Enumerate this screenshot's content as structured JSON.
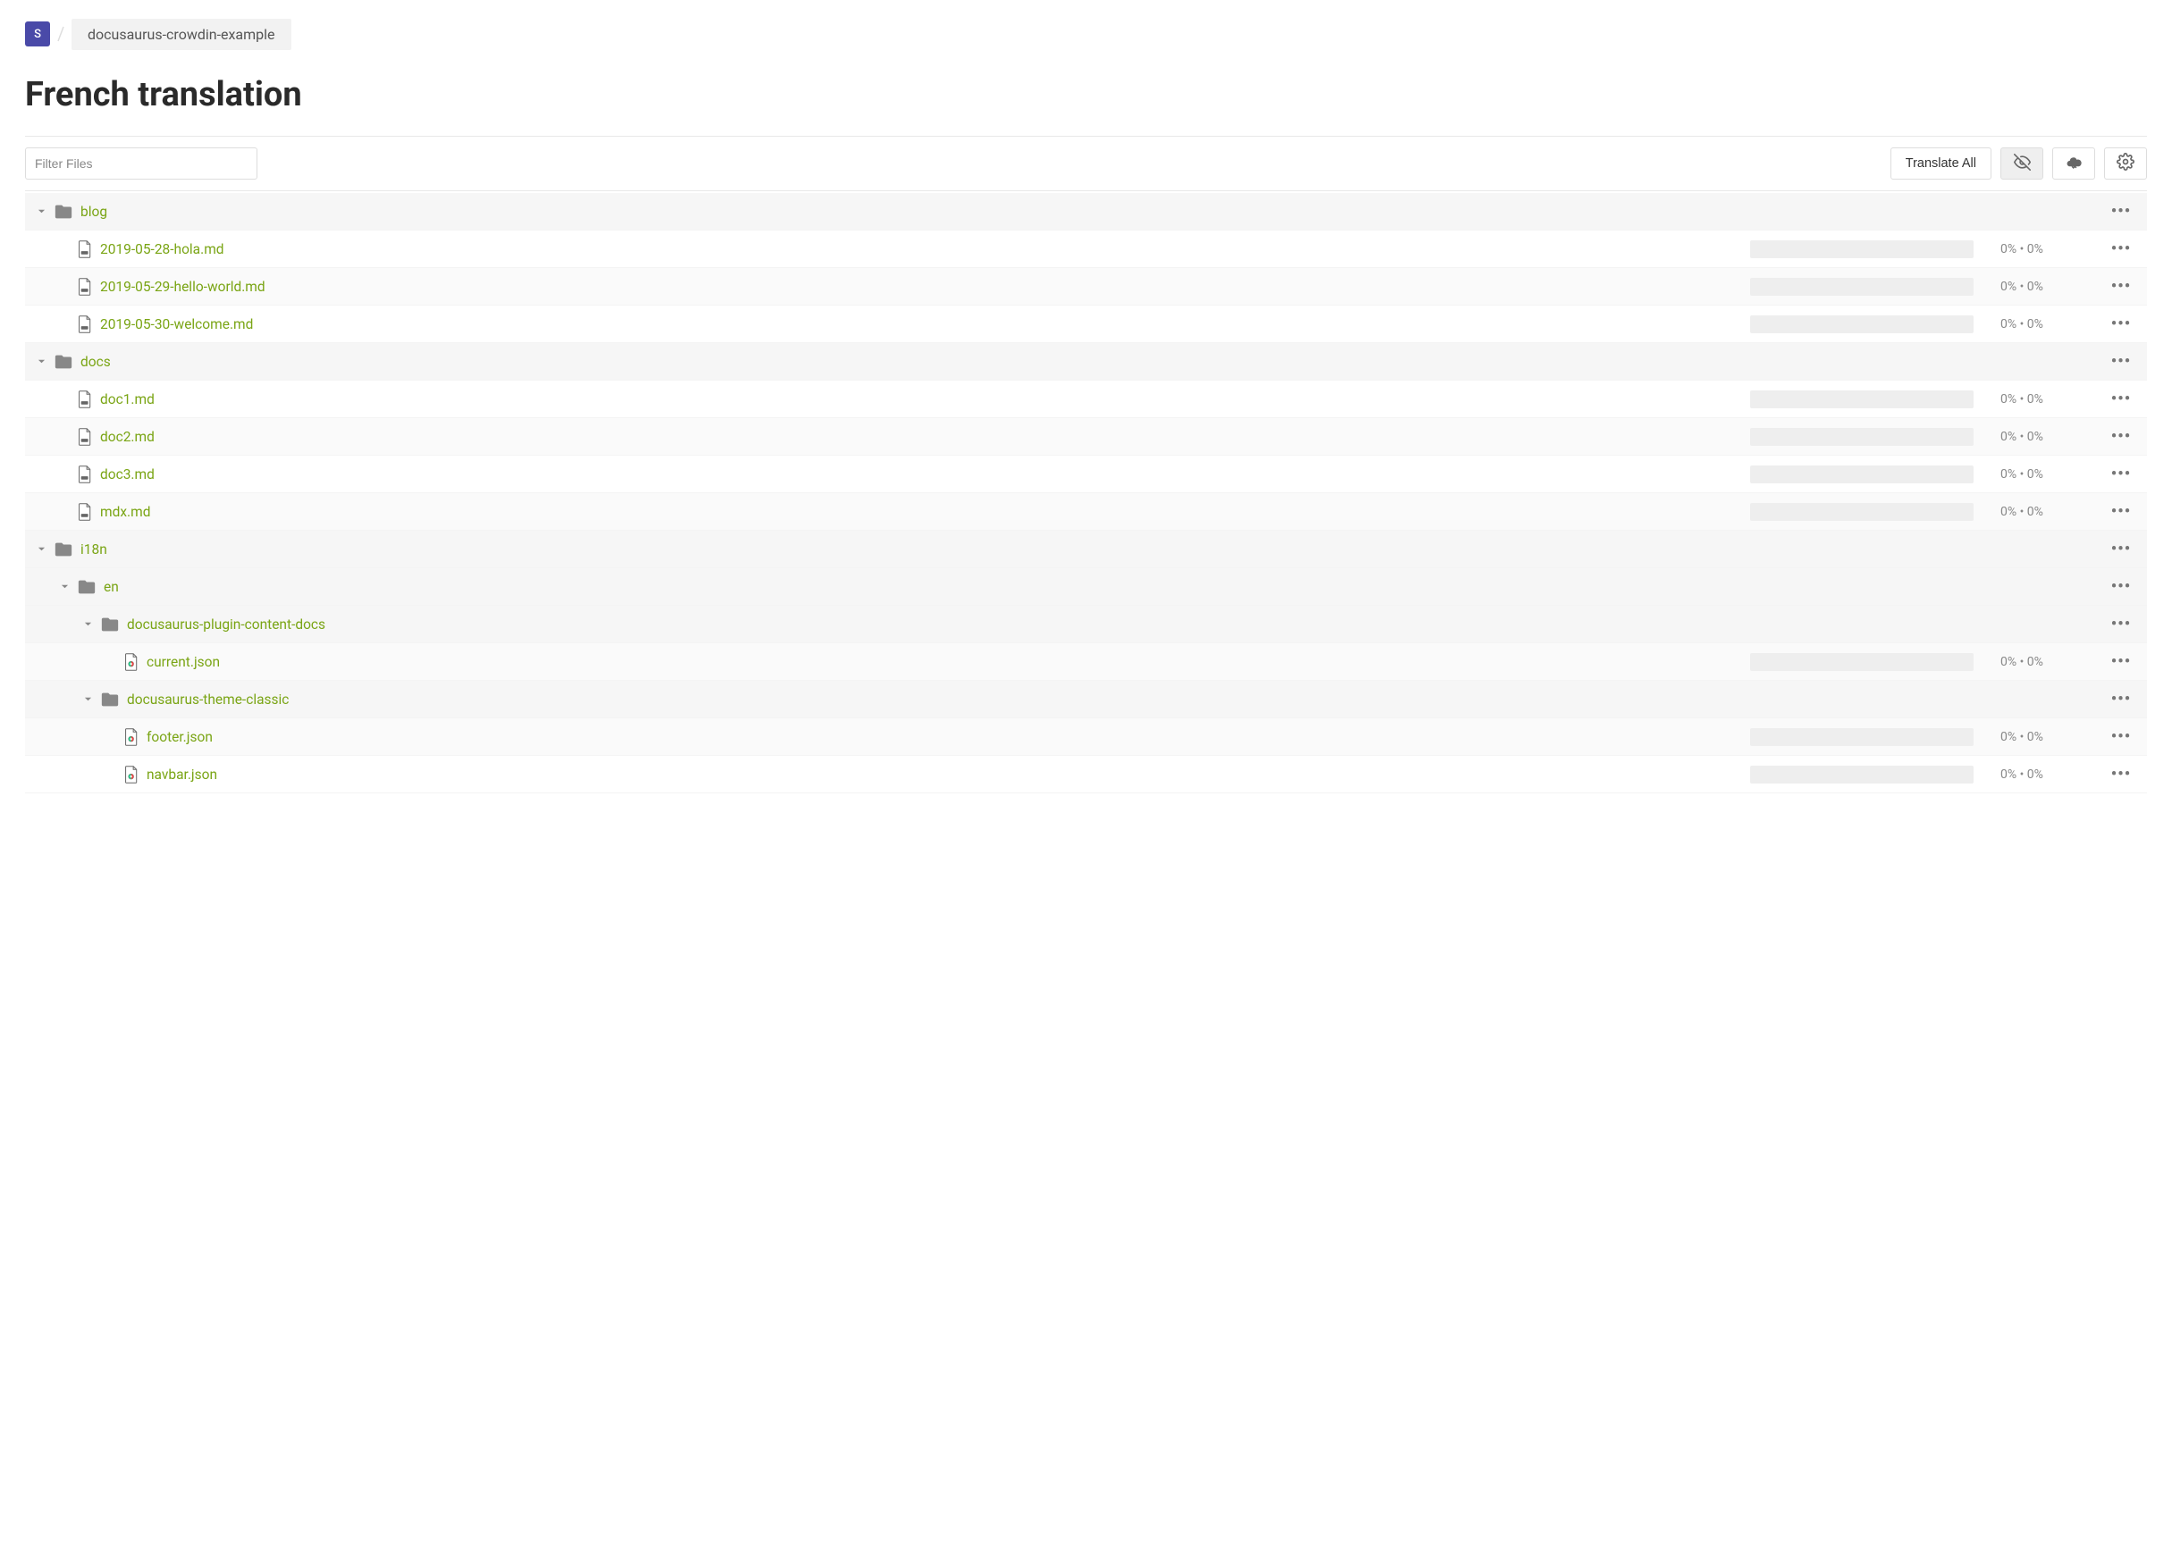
{
  "breadcrumb": {
    "badge_letter": "S",
    "project_name": "docusaurus-crowdin-example"
  },
  "page_title": "French translation",
  "toolbar": {
    "filter_placeholder": "Filter Files",
    "translate_all_label": "Translate All"
  },
  "progress_text_default": "0% • 0%",
  "tree": [
    {
      "type": "folder",
      "depth": 0,
      "name": "blog",
      "striped": true
    },
    {
      "type": "file",
      "depth": 1,
      "name": "2019-05-28-hola.md",
      "kind": "md",
      "progress": "0% • 0%",
      "striped": false
    },
    {
      "type": "file",
      "depth": 1,
      "name": "2019-05-29-hello-world.md",
      "kind": "md",
      "progress": "0% • 0%",
      "striped": true
    },
    {
      "type": "file",
      "depth": 1,
      "name": "2019-05-30-welcome.md",
      "kind": "md",
      "progress": "0% • 0%",
      "striped": false
    },
    {
      "type": "folder",
      "depth": 0,
      "name": "docs",
      "striped": true
    },
    {
      "type": "file",
      "depth": 1,
      "name": "doc1.md",
      "kind": "md",
      "progress": "0% • 0%",
      "striped": false
    },
    {
      "type": "file",
      "depth": 1,
      "name": "doc2.md",
      "kind": "md",
      "progress": "0% • 0%",
      "striped": true
    },
    {
      "type": "file",
      "depth": 1,
      "name": "doc3.md",
      "kind": "md",
      "progress": "0% • 0%",
      "striped": false
    },
    {
      "type": "file",
      "depth": 1,
      "name": "mdx.md",
      "kind": "md",
      "progress": "0% • 0%",
      "striped": true
    },
    {
      "type": "folder",
      "depth": 0,
      "name": "i18n",
      "striped": false
    },
    {
      "type": "folder",
      "depth": 1,
      "name": "en",
      "striped": true
    },
    {
      "type": "folder",
      "depth": 2,
      "name": "docusaurus-plugin-content-docs",
      "striped": false
    },
    {
      "type": "file",
      "depth": 3,
      "name": "current.json",
      "kind": "json",
      "progress": "0% • 0%",
      "striped": true
    },
    {
      "type": "folder",
      "depth": 2,
      "name": "docusaurus-theme-classic",
      "striped": false
    },
    {
      "type": "file",
      "depth": 3,
      "name": "footer.json",
      "kind": "json",
      "progress": "0% • 0%",
      "striped": true
    },
    {
      "type": "file",
      "depth": 3,
      "name": "navbar.json",
      "kind": "json",
      "progress": "0% • 0%",
      "striped": false
    }
  ]
}
